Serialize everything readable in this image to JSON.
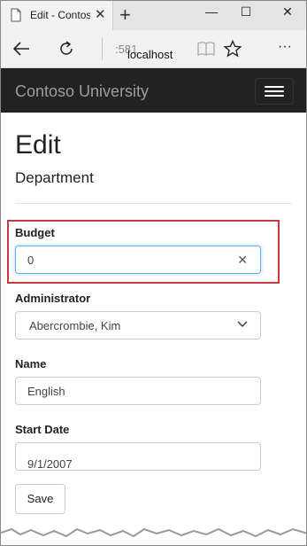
{
  "browser": {
    "tab_title": "Edit - Contoso",
    "tab_close": "✕",
    "new_tab": "+",
    "window_minimize": "—",
    "window_maximize": "☐",
    "window_close": "✕",
    "address_host": "localhost",
    "address_port": ":581",
    "more_menu": "···"
  },
  "site": {
    "brand": "Contoso University"
  },
  "page": {
    "title": "Edit",
    "subtitle": "Department"
  },
  "form": {
    "budget_label": "Budget",
    "budget_value": "0",
    "budget_clear": "✕",
    "administrator_label": "Administrator",
    "administrator_value": "Abercrombie, Kim",
    "name_label": "Name",
    "name_value": "English",
    "start_date_label": "Start Date",
    "start_date_value": "9/1/2007",
    "save_label": "Save"
  },
  "colors": {
    "header_bg": "#222222",
    "highlight_border": "#c8383f",
    "focus_border": "#66afe9"
  }
}
